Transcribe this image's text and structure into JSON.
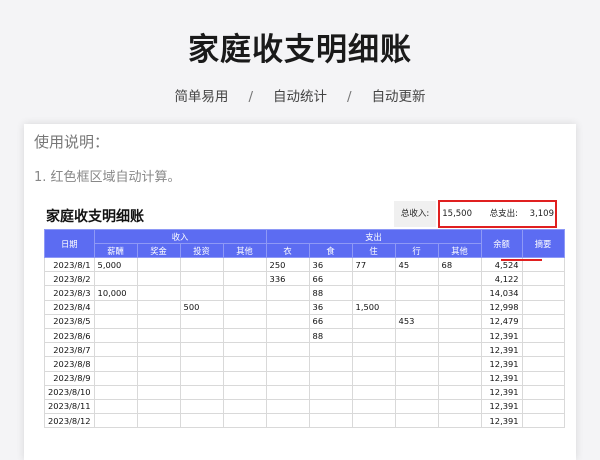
{
  "header": {
    "title": "家庭收支明细账",
    "features": [
      "简单易用",
      "自动统计",
      "自动更新"
    ],
    "separator": "/"
  },
  "usage": {
    "title": "使用说明：",
    "line1": "1. 红色框区域自动计算。"
  },
  "sheet": {
    "title": "家庭收支明细账",
    "total_income_label": "总收入:",
    "total_income": "15,500",
    "total_expense_label": "总支出:",
    "total_expense": "3,109"
  },
  "table": {
    "group_income": "收入",
    "group_expense": "支出",
    "col_date": "日期",
    "col_balance": "余额",
    "col_note": "摘要",
    "income_cols": [
      "薪酬",
      "奖金",
      "投资",
      "其他"
    ],
    "expense_cols": [
      "衣",
      "食",
      "住",
      "行",
      "其他"
    ],
    "rows": [
      {
        "date": "2023/8/1",
        "income": [
          "5,000",
          "",
          "",
          ""
        ],
        "expense": [
          "250",
          "36",
          "77",
          "45",
          "68"
        ],
        "balance": "4,524",
        "note": ""
      },
      {
        "date": "2023/8/2",
        "income": [
          "",
          "",
          "",
          ""
        ],
        "expense": [
          "336",
          "66",
          "",
          "",
          ""
        ],
        "balance": "4,122",
        "note": ""
      },
      {
        "date": "2023/8/3",
        "income": [
          "10,000",
          "",
          "",
          ""
        ],
        "expense": [
          "",
          "88",
          "",
          "",
          ""
        ],
        "balance": "14,034",
        "note": ""
      },
      {
        "date": "2023/8/4",
        "income": [
          "",
          "",
          "500",
          ""
        ],
        "expense": [
          "",
          "36",
          "1,500",
          "",
          ""
        ],
        "balance": "12,998",
        "note": ""
      },
      {
        "date": "2023/8/5",
        "income": [
          "",
          "",
          "",
          ""
        ],
        "expense": [
          "",
          "66",
          "",
          "453",
          ""
        ],
        "balance": "12,479",
        "note": ""
      },
      {
        "date": "2023/8/6",
        "income": [
          "",
          "",
          "",
          ""
        ],
        "expense": [
          "",
          "88",
          "",
          "",
          ""
        ],
        "balance": "12,391",
        "note": ""
      },
      {
        "date": "2023/8/7",
        "income": [
          "",
          "",
          "",
          ""
        ],
        "expense": [
          "",
          "",
          "",
          "",
          ""
        ],
        "balance": "12,391",
        "note": ""
      },
      {
        "date": "2023/8/8",
        "income": [
          "",
          "",
          "",
          ""
        ],
        "expense": [
          "",
          "",
          "",
          "",
          ""
        ],
        "balance": "12,391",
        "note": ""
      },
      {
        "date": "2023/8/9",
        "income": [
          "",
          "",
          "",
          ""
        ],
        "expense": [
          "",
          "",
          "",
          "",
          ""
        ],
        "balance": "12,391",
        "note": ""
      },
      {
        "date": "2023/8/10",
        "income": [
          "",
          "",
          "",
          ""
        ],
        "expense": [
          "",
          "",
          "",
          "",
          ""
        ],
        "balance": "12,391",
        "note": ""
      },
      {
        "date": "2023/8/11",
        "income": [
          "",
          "",
          "",
          ""
        ],
        "expense": [
          "",
          "",
          "",
          "",
          ""
        ],
        "balance": "12,391",
        "note": ""
      },
      {
        "date": "2023/8/12",
        "income": [
          "",
          "",
          "",
          ""
        ],
        "expense": [
          "",
          "",
          "",
          "",
          ""
        ],
        "balance": "12,391",
        "note": ""
      }
    ]
  },
  "colors": {
    "header_blue": "#5c6cf2",
    "highlight_red": "#e02020"
  }
}
